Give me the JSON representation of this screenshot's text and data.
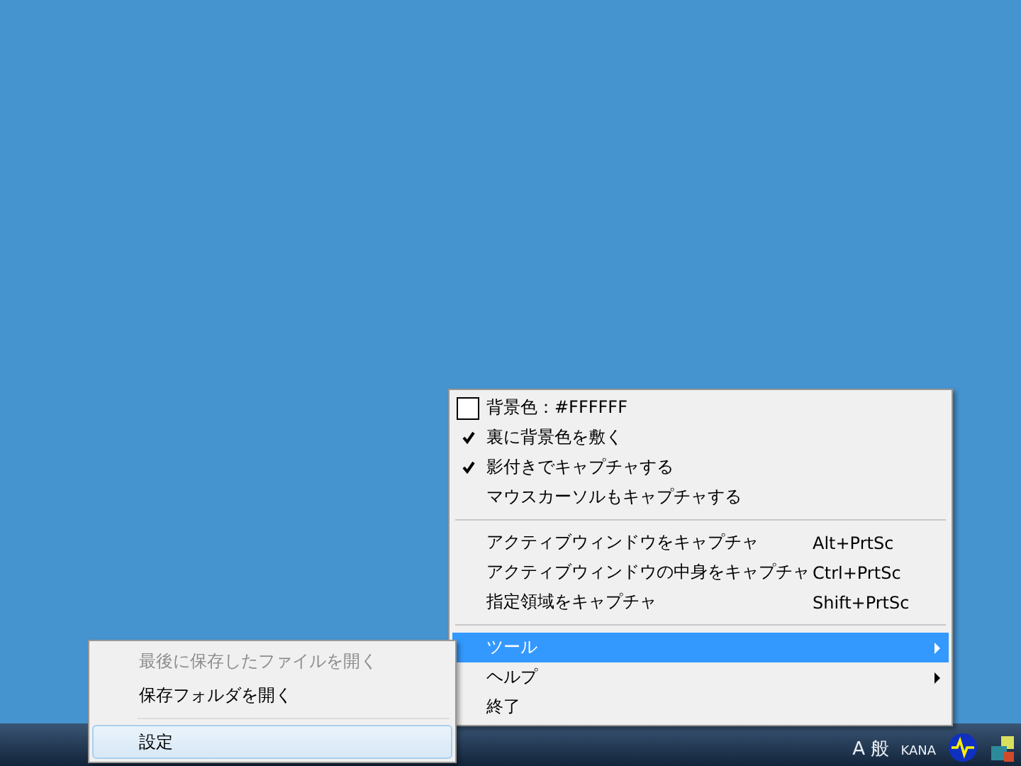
{
  "context_menu": {
    "items": [
      {
        "kind": "color",
        "label": "背景色：#FFFFFF",
        "color": "#ffffff"
      },
      {
        "kind": "check",
        "label": "裏に背景色を敷く",
        "checked": true
      },
      {
        "kind": "check",
        "label": "影付きでキャプチャする",
        "checked": true
      },
      {
        "kind": "check",
        "label": "マウスカーソルもキャプチャする",
        "checked": false
      },
      {
        "kind": "separator"
      },
      {
        "kind": "command",
        "label": "アクティブウィンドウをキャプチャ",
        "shortcut": "Alt+PrtSc"
      },
      {
        "kind": "command",
        "label": "アクティブウィンドウの中身をキャプチャ",
        "shortcut": "Ctrl+PrtSc"
      },
      {
        "kind": "command",
        "label": "指定領域をキャプチャ",
        "shortcut": "Shift+PrtSc"
      },
      {
        "kind": "separator"
      },
      {
        "kind": "submenu",
        "label": "ツール",
        "selected": true
      },
      {
        "kind": "submenu",
        "label": "ヘルプ",
        "selected": false
      },
      {
        "kind": "command",
        "label": "終了"
      }
    ]
  },
  "submenu": {
    "items": [
      {
        "kind": "item",
        "label": "最後に保存したファイルを開く",
        "disabled": true,
        "selected": false
      },
      {
        "kind": "item",
        "label": "保存フォルダを開く",
        "disabled": false,
        "selected": false
      },
      {
        "kind": "separator"
      },
      {
        "kind": "item",
        "label": "設定",
        "disabled": false,
        "selected": true
      }
    ]
  },
  "taskbar": {
    "ime_mode": "A 般",
    "kana_label": "KANA"
  }
}
